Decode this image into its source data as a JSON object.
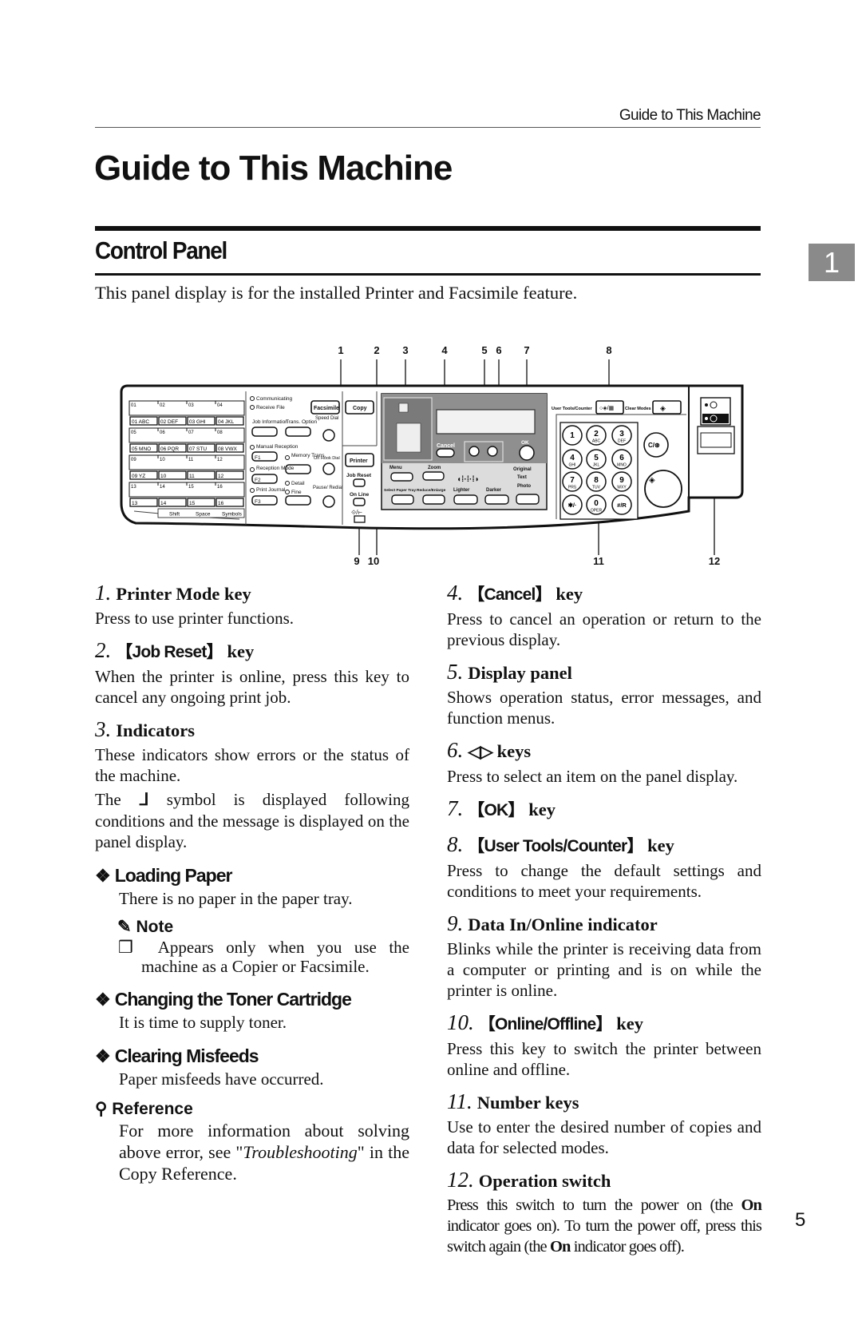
{
  "running_header": "Guide to This Machine",
  "page_title": "Guide to This Machine",
  "section_title": "Control Panel",
  "chapter_tab": "1",
  "intro": "This panel display is for the installed Printer and Facsimile feature.",
  "page_number": "5",
  "diagram": {
    "callouts_top": [
      "1",
      "2",
      "3",
      "4",
      "5",
      "6",
      "7",
      "8"
    ],
    "callouts_bottom": [
      "9",
      "10",
      "11",
      "12"
    ],
    "one_touch_top": [
      "01",
      "02",
      "03",
      "04",
      "05",
      "06",
      "07",
      "08",
      "09",
      "10",
      "11",
      "12",
      "13",
      "14",
      "15",
      "16"
    ],
    "one_touch_keys": [
      "01 ABC",
      "02 DEF",
      "03 GHI",
      "04 JKL",
      "05 MNO",
      "06 PQR",
      "07 STU",
      "08 VWX",
      "09 YZ",
      "10",
      "11",
      "12",
      "13",
      "14",
      "15",
      "16"
    ],
    "one_touch_footer": [
      "Shift",
      "Space",
      "Symbols"
    ],
    "labels": {
      "communicating": "Communicating",
      "receive_file": "Receive File",
      "facsimile": "Facsimile",
      "copy": "Copy",
      "job_information": "Job Information",
      "trans_option": "Trans. Option",
      "speed_dial": "Speed Dial",
      "manual_reception": "Manual Reception",
      "f1": "F1",
      "memory_trans": "Memory Trans.",
      "on_hook_dial": "On Hook Dial",
      "printer": "Printer",
      "reception_mode": "Reception Mode",
      "f2": "F2",
      "detail": "Detail",
      "fine": "Fine",
      "job_reset": "Job Reset",
      "print_journal": "Print Journal",
      "f3": "F3",
      "pause_redial": "Pause/ Redial",
      "on_line": "On Line",
      "cancel": "Cancel",
      "ok": "OK",
      "menu": "Menu",
      "zoom": "Zoom",
      "select_paper_tray": "Select Paper Tray",
      "reduce_enlarge": "Reduce/Enlarge",
      "lighter": "Lighter",
      "darker": "Darker",
      "original": "Original",
      "text": "Text",
      "photo": "Photo",
      "user_tools_counter": "User Tools/Counter",
      "clear_modes": "Clear Modes",
      "clear_stop": "C/⊛"
    },
    "keypad": [
      {
        "d": "1",
        "s": ""
      },
      {
        "d": "2",
        "s": "ABC"
      },
      {
        "d": "3",
        "s": "DEF"
      },
      {
        "d": "4",
        "s": "GHI"
      },
      {
        "d": "5",
        "s": "JKL"
      },
      {
        "d": "6",
        "s": "MNO"
      },
      {
        "d": "7",
        "s": "PRS"
      },
      {
        "d": "8",
        "s": "TUV"
      },
      {
        "d": "9",
        "s": "WXY"
      },
      {
        "d": "✱/·",
        "s": ""
      },
      {
        "d": "0",
        "s": "OPER"
      },
      {
        "d": "#/R",
        "s": ""
      }
    ]
  },
  "left_column": {
    "items": [
      {
        "num": "1.",
        "title": "Printer Mode key",
        "body": "Press to use printer functions."
      },
      {
        "num": "2.",
        "key": "【Job Reset】",
        "title": "key",
        "body": "When the printer is online, press this key to cancel any ongoing print job."
      },
      {
        "num": "3.",
        "title": "Indicators",
        "body": "These indicators show errors or the status of the machine.",
        "body2_pre": "The",
        "body2_symbol": "ᒧ",
        "body2_post": "symbol is displayed following conditions and the message is displayed on the panel display."
      }
    ],
    "loading_paper": {
      "bullet": "❖",
      "title": "Loading Paper",
      "body": "There is no paper in the paper tray."
    },
    "note": {
      "title": "Note",
      "checkbox": "❒",
      "body": "Appears only when you use the machine as a Copier or Facsimile."
    },
    "toner": {
      "bullet": "❖",
      "title": "Changing the Toner Cartridge",
      "body": "It is time to supply toner."
    },
    "misfeeds": {
      "bullet": "❖",
      "title": "Clearing Misfeeds",
      "body": "Paper misfeeds have occurred."
    },
    "reference": {
      "title": "Reference",
      "body_pre": "For more information about solving above error, see \"",
      "body_italic": "Troubleshooting",
      "body_post": "\" in the Copy Reference."
    }
  },
  "right_column": {
    "items": [
      {
        "num": "4.",
        "key": "【Cancel】",
        "title": "key",
        "body": "Press to cancel an operation or return to the previous display."
      },
      {
        "num": "5.",
        "title": "Display panel",
        "body": "Shows operation status, error messages, and function menus."
      },
      {
        "num": "6.",
        "key": "◁▷",
        "title": "keys",
        "body": "Press to select an item on the panel display."
      },
      {
        "num": "7.",
        "key": "【OK】",
        "title": "key",
        "body": ""
      },
      {
        "num": "8.",
        "key": "【User Tools/Counter】",
        "title": "key",
        "body": "Press to change the default settings and conditions to meet your requirements."
      },
      {
        "num": "9.",
        "title": "Data In/Online indicator",
        "body": "Blinks while the printer is receiving data from a computer or printing and is on while the printer is online."
      },
      {
        "num": "10.",
        "key": "【Online/Offline】",
        "title": "key",
        "body": "Press this key to switch the printer between online and offline."
      },
      {
        "num": "11.",
        "title": "Number keys",
        "body": "Use to enter the desired number of copies and data for selected modes."
      },
      {
        "num": "12.",
        "title": "Operation switch",
        "body_a": "Press this switch to turn the power on (the",
        "body_b": "On",
        "body_c": "indicator goes on). To turn the power off, press this switch again (the",
        "body_d": "On",
        "body_e": "indicator goes off)."
      }
    ]
  }
}
